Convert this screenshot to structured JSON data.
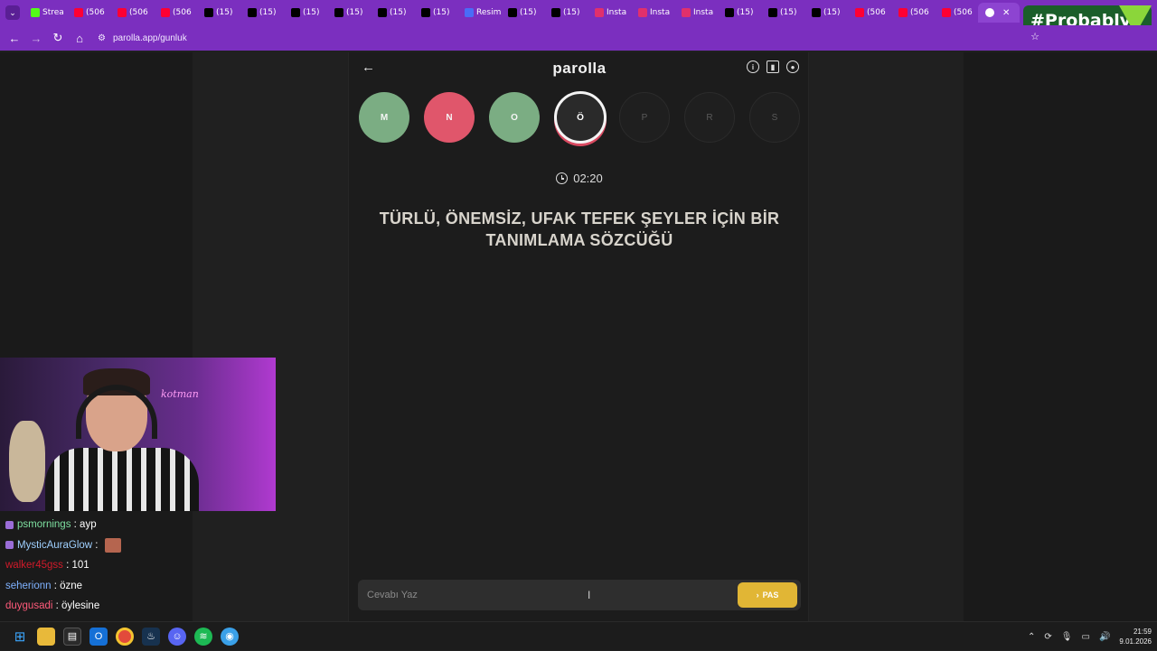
{
  "browser": {
    "tabs": [
      {
        "label": "Strea",
        "icon": "kick-icon",
        "color": "#53fc18"
      },
      {
        "label": "(506",
        "icon": "youtube-icon",
        "color": "#ff0033"
      },
      {
        "label": "(506",
        "icon": "youtube-icon",
        "color": "#ff0033"
      },
      {
        "label": "(506",
        "icon": "youtube-icon",
        "color": "#ff0033"
      },
      {
        "label": "(15)",
        "icon": "x-icon",
        "color": "#000000"
      },
      {
        "label": "(15)",
        "icon": "x-icon",
        "color": "#000000"
      },
      {
        "label": "(15)",
        "icon": "x-icon",
        "color": "#000000"
      },
      {
        "label": "(15)",
        "icon": "x-icon",
        "color": "#000000"
      },
      {
        "label": "(15)",
        "icon": "x-icon",
        "color": "#000000"
      },
      {
        "label": "(15)",
        "icon": "x-icon",
        "color": "#000000"
      },
      {
        "label": "Resim",
        "icon": "image-icon",
        "color": "#4a6cf7"
      },
      {
        "label": "(15)",
        "icon": "x-icon",
        "color": "#000000"
      },
      {
        "label": "(15)",
        "icon": "x-icon",
        "color": "#000000"
      },
      {
        "label": "Insta",
        "icon": "instagram-icon",
        "color": "#e1306c"
      },
      {
        "label": "Insta",
        "icon": "instagram-icon",
        "color": "#e1306c"
      },
      {
        "label": "Insta",
        "icon": "instagram-icon",
        "color": "#e1306c"
      },
      {
        "label": "(15)",
        "icon": "x-icon",
        "color": "#000000"
      },
      {
        "label": "(15)",
        "icon": "x-icon",
        "color": "#000000"
      },
      {
        "label": "(15)",
        "icon": "x-icon",
        "color": "#000000"
      },
      {
        "label": "(506",
        "icon": "youtube-icon",
        "color": "#ff0033"
      },
      {
        "label": "(506",
        "icon": "youtube-icon",
        "color": "#ff0033"
      },
      {
        "label": "(506",
        "icon": "youtube-icon",
        "color": "#ff0033"
      }
    ],
    "url": "parolla.app/gunluk",
    "brand_badge": "#Probably"
  },
  "app": {
    "title": "parolla",
    "timer": "02:20",
    "question": "TÜRLÜ, ÖNEMSİZ, UFAK TEFEK ŞEYLER İÇİN BİR TANIMLAMA SÖZCÜĞÜ",
    "letters": [
      {
        "letter": "M",
        "state": "correct"
      },
      {
        "letter": "N",
        "state": "wrong"
      },
      {
        "letter": "O",
        "state": "correct"
      },
      {
        "letter": "Ö",
        "state": "current"
      },
      {
        "letter": "P",
        "state": "pending"
      },
      {
        "letter": "R",
        "state": "pending"
      },
      {
        "letter": "S",
        "state": "pending"
      }
    ],
    "answer_placeholder": "Cevabı Yaz",
    "pass_label": "PAS",
    "colors": {
      "correct": "#7bad83",
      "wrong": "#e0566b",
      "pass": "#e1b635"
    }
  },
  "webcam": {
    "neon_text": "kotman"
  },
  "chat": {
    "messages": [
      {
        "user": "psmornings",
        "text": "ayp",
        "user_color": "#7ee0a0",
        "badge": true,
        "emote": false
      },
      {
        "user": "MysticAuraGlow",
        "text": "",
        "user_color": "#9fd0ff",
        "badge": true,
        "emote": true
      },
      {
        "user": "walker45gss",
        "text": "101",
        "user_color": "#d11a2a",
        "badge": false,
        "emote": false
      },
      {
        "user": "seherionn",
        "text": "özne",
        "user_color": "#7fb2ff",
        "badge": false,
        "emote": false
      },
      {
        "user": "duygusadi",
        "text": "öylesine",
        "user_color": "#ff5a7a",
        "badge": false,
        "emote": false
      }
    ]
  },
  "taskbar": {
    "time": "21:59",
    "date": "9.01.2026"
  }
}
